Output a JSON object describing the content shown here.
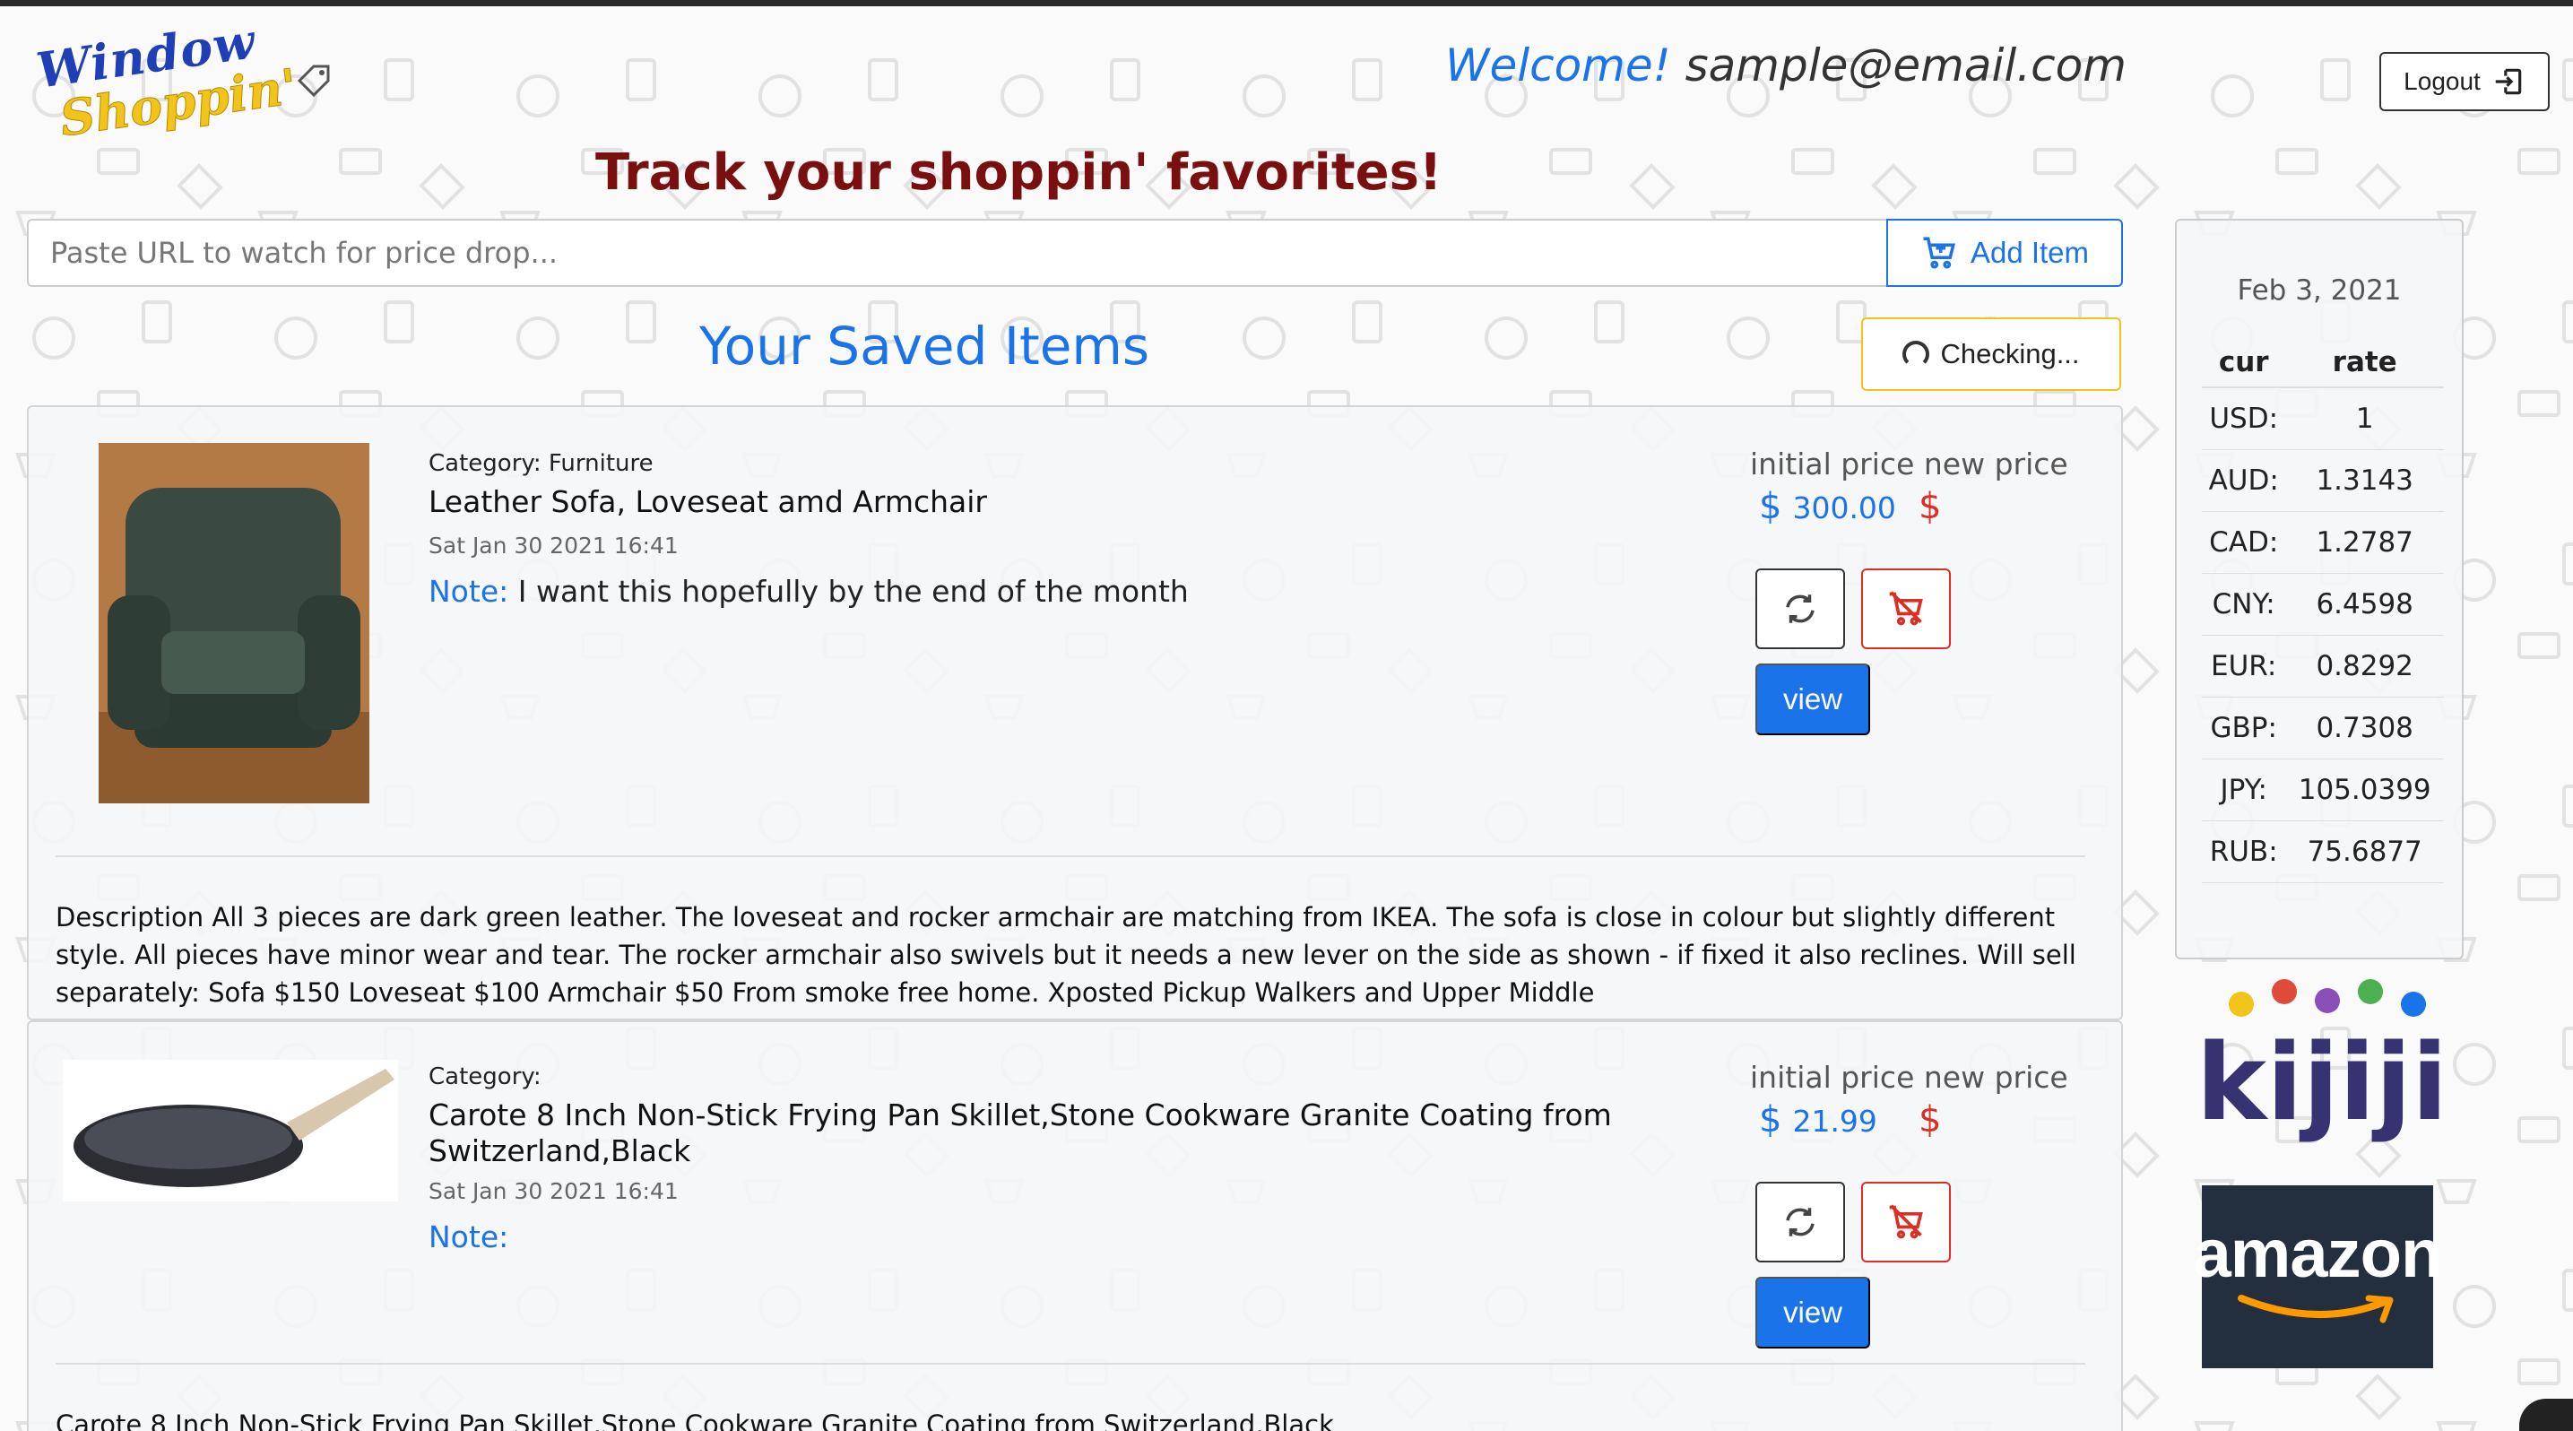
{
  "header": {
    "logo_line1": "Window",
    "logo_line2": "Shoppin'",
    "welcome_label": "Welcome!",
    "user_email": "sample@email.com",
    "logout_label": "Logout",
    "tagline": "Track your shoppin' favorites!"
  },
  "search": {
    "placeholder": "Paste URL to watch for price drop...",
    "value": "",
    "add_label": "Add Item"
  },
  "saved": {
    "title": "Your Saved Items",
    "checking_label": "Checking..."
  },
  "items": [
    {
      "category": "Category: Furniture",
      "name": "Leather Sofa, Loveseat amd Armchair",
      "date": "Sat Jan 30 2021 16:41",
      "note_label": "Note:",
      "note": "I want this hopefully by the end of the month",
      "initial_price_label": "initial price",
      "new_price_label": "new price",
      "currency_symbol": "$",
      "initial_price": "300.00",
      "new_price": "",
      "view_label": "view",
      "description": "Description All 3 pieces are dark green leather. The loveseat and rocker armchair are matching from IKEA. The sofa is close in colour but slightly different style. All pieces have minor wear and tear. The rocker armchair also swivels but it needs a new lever on the side as shown - if fixed it also reclines. Will sell separately: Sofa $150 Loveseat $100 Armchair $50 From smoke free home. Xposted Pickup Walkers and Upper Middle"
    },
    {
      "category": "Category:",
      "name": "Carote 8 Inch Non-Stick Frying Pan Skillet,Stone Cookware Granite Coating from Switzerland,Black",
      "date": "Sat Jan 30 2021 16:41",
      "note_label": "Note:",
      "note": "",
      "initial_price_label": "initial price",
      "new_price_label": "new price",
      "currency_symbol": "$",
      "initial_price": "21.99",
      "new_price": "",
      "view_label": "view",
      "description": "Carote 8 Inch Non-Stick Frying Pan Skillet,Stone Cookware Granite Coating from Switzerland,Black"
    }
  ],
  "rates": {
    "date": "Feb 3, 2021",
    "headers": [
      "cur",
      "rate"
    ],
    "rows": [
      {
        "cur": "USD:",
        "rate": "1"
      },
      {
        "cur": "AUD:",
        "rate": "1.3143"
      },
      {
        "cur": "CAD:",
        "rate": "1.2787"
      },
      {
        "cur": "CNY:",
        "rate": "6.4598"
      },
      {
        "cur": "EUR:",
        "rate": "0.8292"
      },
      {
        "cur": "GBP:",
        "rate": "0.7308"
      },
      {
        "cur": "JPY:",
        "rate": "105.0399"
      },
      {
        "cur": "RUB:",
        "rate": "75.6877"
      }
    ]
  },
  "brands": {
    "kijiji": "kijiji",
    "amazon": "amazon"
  },
  "colors": {
    "accent": "#1a73e8",
    "tagline": "#7a0f0f",
    "danger": "#d93025",
    "warning": "#f2c318",
    "amazon_bg": "#232f3e",
    "kijiji_text": "#373373"
  },
  "icons": [
    "cart-plus-icon",
    "logout-icon",
    "refresh-icon",
    "cart-remove-icon",
    "spinner-icon"
  ]
}
